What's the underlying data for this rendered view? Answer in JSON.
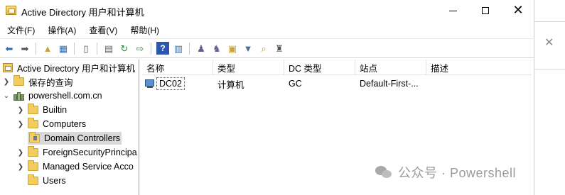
{
  "window": {
    "title": "Active Directory 用户和计算机"
  },
  "menu": [
    "文件(F)",
    "操作(A)",
    "查看(V)",
    "帮助(H)"
  ],
  "toolbar": {
    "icons": [
      "back-arrow",
      "forward-arrow",
      "up-folder",
      "show-tree",
      "copy",
      "export-list",
      "refresh",
      "properties-export",
      "help",
      "mmc-view",
      "new-user",
      "new-group",
      "new-ou",
      "filter",
      "find",
      "add-to-group"
    ]
  },
  "tree": {
    "root": "Active Directory 用户和计算机",
    "items": [
      {
        "label": "保存的查询"
      },
      {
        "label": "powershell.com.cn"
      },
      {
        "label": "Builtin"
      },
      {
        "label": "Computers"
      },
      {
        "label": "Domain Controllers"
      },
      {
        "label": "ForeignSecurityPrincipa"
      },
      {
        "label": "Managed Service Acco"
      },
      {
        "label": "Users"
      }
    ],
    "selected": "Domain Controllers"
  },
  "list": {
    "columns": [
      "名称",
      "类型",
      "DC 类型",
      "站点",
      "描述"
    ],
    "rows": [
      {
        "name": "DC02",
        "type": "计算机",
        "dc_type": "GC",
        "site": "Default-First-...",
        "description": ""
      }
    ]
  },
  "watermark": "公众号 · Powershell",
  "colors": {
    "selection": "#d9d9d9",
    "folder": "#f3cd5b"
  }
}
